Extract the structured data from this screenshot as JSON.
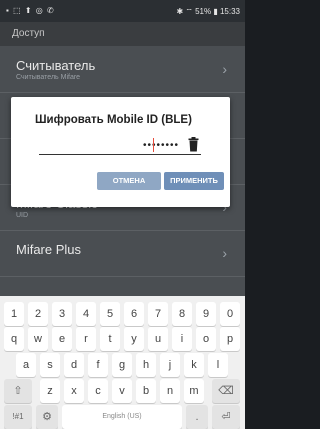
{
  "status_bar": {
    "left_icons": "▪ ⬚ ⬆ ◎ ✆",
    "right_text": "✱ ⌔ 51% ▮ 15:33"
  },
  "app_bar": {
    "title": "Доступ"
  },
  "list": [
    {
      "title": "Считыватель",
      "subtitle": "Считыватель Mifare"
    },
    {
      "title": "",
      "subtitle": ""
    },
    {
      "title": "",
      "subtitle": ""
    },
    {
      "title": "Mifare Classic",
      "subtitle": "UID"
    },
    {
      "title": "Mifare Plus",
      "subtitle": ""
    }
  ],
  "dialog": {
    "title": "Шифровать Mobile ID (BLE)",
    "password_value": "••••••••",
    "cancel_label": "ОТМЕНА",
    "apply_label": "ПРИМЕНИТЬ"
  },
  "keyboard": {
    "row1": [
      "1",
      "2",
      "3",
      "4",
      "5",
      "6",
      "7",
      "8",
      "9",
      "0"
    ],
    "row2": [
      "q",
      "w",
      "e",
      "r",
      "t",
      "y",
      "u",
      "i",
      "o",
      "p"
    ],
    "row3": [
      "a",
      "s",
      "d",
      "f",
      "g",
      "h",
      "j",
      "k",
      "l"
    ],
    "row4": [
      "⇧",
      "z",
      "x",
      "c",
      "v",
      "b",
      "n",
      "m",
      "⌫"
    ],
    "row5": [
      "!#1",
      "⚙",
      "English (US)",
      ".",
      "⏎"
    ]
  },
  "colors": {
    "dialog_button": "#6f8fb8",
    "overlay_dim": "#3a3d40"
  }
}
